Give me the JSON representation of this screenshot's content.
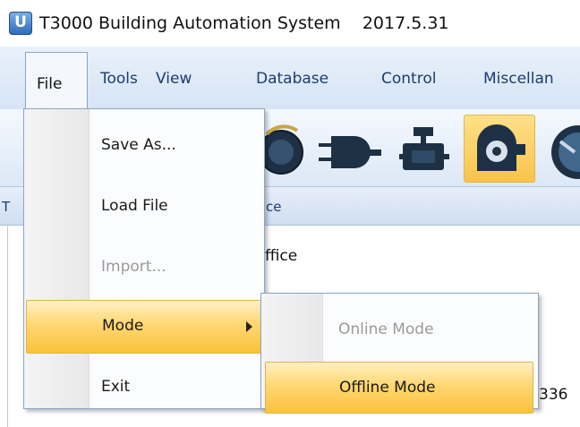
{
  "window": {
    "title": "T3000 Building Automation System    2017.5.31",
    "app_icon": "t3000-app-icon"
  },
  "menubar": {
    "items": [
      "File",
      "Tools",
      "View",
      "Database",
      "Control",
      "Miscellan"
    ]
  },
  "toolbar": {
    "icons": [
      "dial-icon",
      "plug-icon",
      "network-device-icon",
      "fan-icon",
      "gauge-icon"
    ]
  },
  "tabstrip": {
    "left_fragment": "T",
    "right_fragment": "ce"
  },
  "content": {
    "lines": [
      "ffice",
      "336"
    ]
  },
  "file_menu": {
    "items": [
      {
        "label": "Save As...",
        "state": "enabled"
      },
      {
        "label": "Load File",
        "state": "enabled"
      },
      {
        "label": "Import...",
        "state": "disabled"
      },
      {
        "label": "Mode",
        "state": "highlighted",
        "has_submenu": true
      },
      {
        "label": "Exit",
        "state": "enabled"
      }
    ]
  },
  "mode_submenu": {
    "items": [
      {
        "label": "Online Mode",
        "state": "disabled"
      },
      {
        "label": "Offline Mode",
        "state": "highlighted"
      }
    ]
  },
  "colors": {
    "menubar_bg": "#dfe9f6",
    "highlight": "#fbc23a",
    "highlight_border": "#e0b44c",
    "disabled_text": "#9a9a9a",
    "menu_text": "#1c3d6e"
  }
}
